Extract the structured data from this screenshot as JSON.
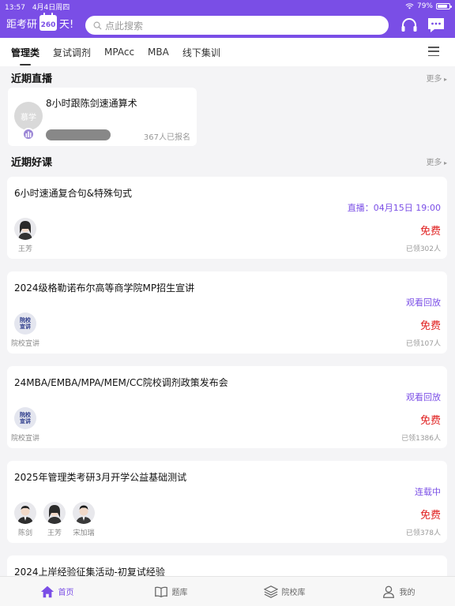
{
  "status_bar": {
    "time": "13:57",
    "date": "4月4日周四",
    "battery": "79%"
  },
  "header": {
    "countdown_prefix": "距考研",
    "countdown_days": "260",
    "countdown_suffix": "天!",
    "search_placeholder": "点此搜索"
  },
  "tabs": [
    "管理类",
    "复试调剂",
    "MPAcc",
    "MBA",
    "线下集训"
  ],
  "recent_live": {
    "heading": "近期直播",
    "more": "更多",
    "card": {
      "avatar_text": "慕学",
      "title": "8小时跟陈剑速通算术",
      "count": "367人已报名"
    }
  },
  "good_courses": {
    "heading": "近期好课",
    "more": "更多",
    "items": [
      {
        "title": "6小时速通复合句&特殊句式",
        "status": "直播：04月15日 19:00",
        "price": "免费",
        "enrolled": "已领302人",
        "teachers": [
          "王芳"
        ]
      },
      {
        "title": "2024级格勒诺布尔高等商学院MP招生宣讲",
        "status": "观看回放",
        "price": "免费",
        "enrolled": "已领107人",
        "teachers": [
          "院校宣讲"
        ],
        "badge": "院校宣讲"
      },
      {
        "title": "24MBA/EMBA/MPA/MEM/CC院校调剂政策发布会",
        "status": "观看回放",
        "price": "免费",
        "enrolled": "已领1386人",
        "teachers": [
          "院校宣讲"
        ],
        "badge": "院校宣讲"
      },
      {
        "title": "2025年管理类考研3月开学公益基础测试",
        "status": "连载中",
        "price": "免费",
        "enrolled": "已领378人",
        "teachers": [
          "陈剑",
          "王芳",
          "宋加瑞"
        ]
      },
      {
        "title": "2024上岸经验征集活动-初复试经验"
      }
    ]
  },
  "bottom_nav": [
    {
      "label": "首页",
      "icon": "home-icon"
    },
    {
      "label": "题库",
      "icon": "book-icon"
    },
    {
      "label": "院校库",
      "icon": "layers-icon"
    },
    {
      "label": "我的",
      "icon": "person-icon"
    }
  ],
  "colors": {
    "accent": "#7a4ee6",
    "price": "#e02020"
  }
}
